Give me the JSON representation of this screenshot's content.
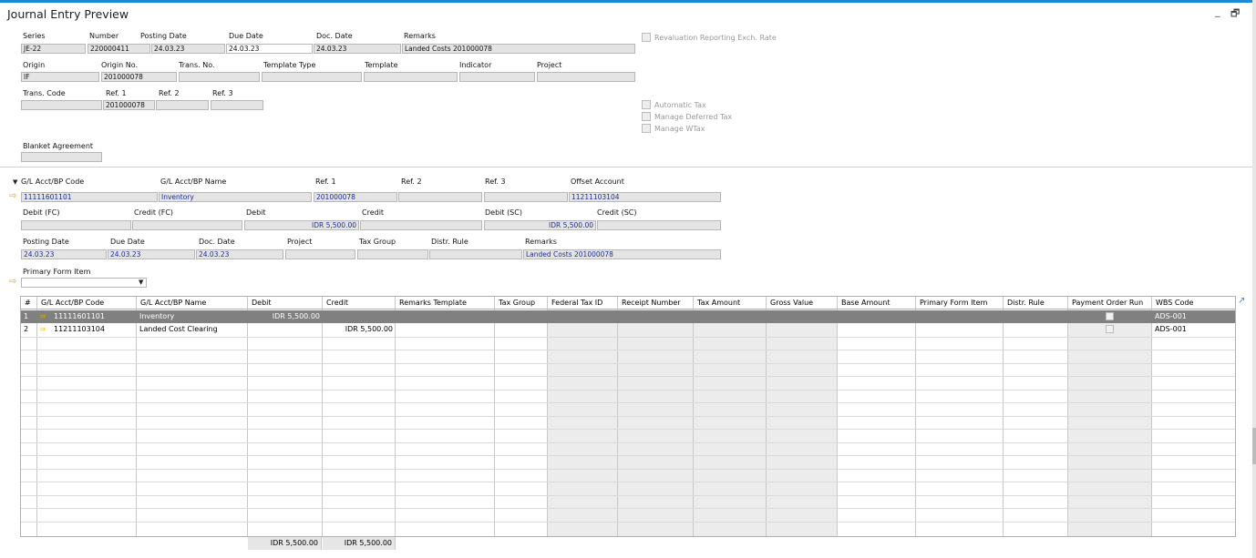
{
  "window": {
    "title": "Journal Entry Preview"
  },
  "header": {
    "series": {
      "label": "Series",
      "value": "JE-22"
    },
    "number": {
      "label": "Number",
      "value": "220000411"
    },
    "posting_date": {
      "label": "Posting Date",
      "value": "24.03.23"
    },
    "due_date": {
      "label": "Due Date",
      "value": "24.03.23"
    },
    "doc_date": {
      "label": "Doc. Date",
      "value": "24.03.23"
    },
    "remarks": {
      "label": "Remarks",
      "value": "Landed Costs 201000078"
    },
    "origin": {
      "label": "Origin",
      "value": "IF"
    },
    "origin_no": {
      "label": "Origin No.",
      "value": "201000078"
    },
    "trans_no": {
      "label": "Trans. No.",
      "value": ""
    },
    "template_type": {
      "label": "Template Type",
      "value": ""
    },
    "template": {
      "label": "Template",
      "value": ""
    },
    "indicator": {
      "label": "Indicator",
      "value": ""
    },
    "project": {
      "label": "Project",
      "value": ""
    },
    "trans_code": {
      "label": "Trans. Code",
      "value": ""
    },
    "ref1": {
      "label": "Ref. 1",
      "value": "201000078"
    },
    "ref2": {
      "label": "Ref. 2",
      "value": ""
    },
    "ref3": {
      "label": "Ref. 3",
      "value": ""
    },
    "blanket_agreement": {
      "label": "Blanket Agreement",
      "value": ""
    }
  },
  "checkboxes": {
    "revaluation": "Revaluation Reporting Exch. Rate",
    "automatic_tax": "Automatic Tax",
    "manage_deferred_tax": "Manage Deferred Tax",
    "manage_wtax": "Manage WTax"
  },
  "detail": {
    "gl_code": {
      "label": "G/L Acct/BP Code",
      "value": "11111601101"
    },
    "gl_name": {
      "label": "G/L Acct/BP Name",
      "value": "Inventory"
    },
    "ref1": {
      "label": "Ref. 1",
      "value": "201000078"
    },
    "ref2": {
      "label": "Ref. 2",
      "value": ""
    },
    "ref3": {
      "label": "Ref. 3",
      "value": ""
    },
    "offset_account": {
      "label": "Offset Account",
      "value": "11211103104"
    },
    "debit_fc": {
      "label": "Debit (FC)",
      "value": ""
    },
    "credit_fc": {
      "label": "Credit (FC)",
      "value": ""
    },
    "debit": {
      "label": "Debit",
      "value": "IDR 5,500.00"
    },
    "credit": {
      "label": "Credit",
      "value": ""
    },
    "debit_sc": {
      "label": "Debit (SC)",
      "value": "IDR 5,500.00"
    },
    "credit_sc": {
      "label": "Credit (SC)",
      "value": ""
    },
    "posting_date": {
      "label": "Posting Date",
      "value": "24.03.23"
    },
    "due_date": {
      "label": "Due Date",
      "value": "24.03.23"
    },
    "doc_date": {
      "label": "Doc. Date",
      "value": "24.03.23"
    },
    "project": {
      "label": "Project",
      "value": ""
    },
    "tax_group": {
      "label": "Tax Group",
      "value": ""
    },
    "distr_rule": {
      "label": "Distr. Rule",
      "value": ""
    },
    "remarks": {
      "label": "Remarks",
      "value": "Landed Costs 201000078"
    },
    "primary_form_item": {
      "label": "Primary Form Item",
      "value": ""
    }
  },
  "table": {
    "columns": [
      "#",
      "G/L Acct/BP Code",
      "G/L Acct/BP Name",
      "Debit",
      "Credit",
      "Remarks Template",
      "Tax Group",
      "Federal Tax ID",
      "Receipt Number",
      "Tax Amount",
      "Gross Value",
      "Base Amount",
      "Primary Form Item",
      "Distr. Rule",
      "Payment Order Run",
      "WBS Code"
    ],
    "rows": [
      {
        "num": "1",
        "code": "11111601101",
        "name": "Inventory",
        "debit": "IDR 5,500.00",
        "credit": "",
        "wbs": "ADS-001"
      },
      {
        "num": "2",
        "code": "11211103104",
        "name": "Landed Cost Clearing",
        "debit": "",
        "credit": "IDR 5,500.00",
        "wbs": "ADS-001"
      }
    ],
    "totals": {
      "debit": "IDR 5,500.00",
      "credit": "IDR 5,500.00"
    }
  },
  "icons": {
    "link_arrow": "⇨",
    "minimize": "_",
    "restore": "🗗",
    "expand": "↗",
    "collapse": "▼",
    "dropdown": "▼"
  }
}
